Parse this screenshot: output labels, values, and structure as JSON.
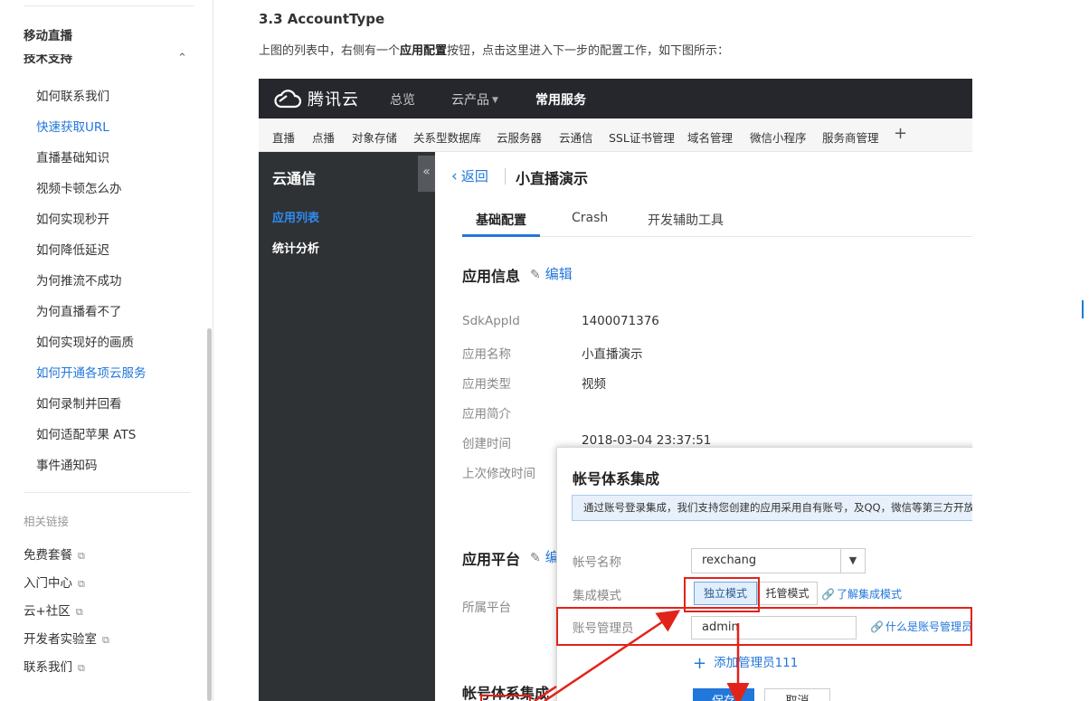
{
  "sidebar": {
    "section_live": "移动直播",
    "section_support": "技术支持",
    "items": [
      {
        "label": "如何联系我们",
        "active": false
      },
      {
        "label": "快速获取URL",
        "active": true
      },
      {
        "label": "直播基础知识",
        "active": false
      },
      {
        "label": "视频卡顿怎么办",
        "active": false
      },
      {
        "label": "如何实现秒开",
        "active": false
      },
      {
        "label": "如何降低延迟",
        "active": false
      },
      {
        "label": "为何推流不成功",
        "active": false
      },
      {
        "label": "为何直播看不了",
        "active": false
      },
      {
        "label": "如何实现好的画质",
        "active": false
      },
      {
        "label": "如何开通各项云服务",
        "active": true
      },
      {
        "label": "如何录制并回看",
        "active": false
      },
      {
        "label": "如何适配苹果 ATS",
        "active": false
      },
      {
        "label": "事件通知码",
        "active": false
      }
    ],
    "related_title": "相关链接",
    "links": [
      "免费套餐",
      "入门中心",
      "云+社区",
      "开发者实验室",
      "联系我们"
    ]
  },
  "doc": {
    "heading": "3.3 AccountType",
    "para_before": "上图的列表中，右侧有一个",
    "para_bold": "应用配置",
    "para_after": "按钮，点击这里进入下一步的配置工作，如下图所示："
  },
  "console": {
    "brand": "腾讯云",
    "topnav": [
      "总览",
      "云产品",
      "常用服务"
    ],
    "products": [
      "直播",
      "点播",
      "对象存储",
      "关系型数据库",
      "云服务器",
      "云通信",
      "SSL证书管理",
      "域名管理",
      "微信小程序",
      "服务商管理"
    ],
    "leftnav": {
      "title": "云通信",
      "items": [
        "应用列表",
        "统计分析"
      ]
    },
    "back": "返回",
    "app_title": "小直播演示",
    "tabs": [
      "基础配置",
      "Crash",
      "开发辅助工具"
    ],
    "info_section": "应用信息",
    "edit": "编辑",
    "fields": [
      {
        "label": "SdkAppId",
        "value": "1400071376"
      },
      {
        "label": "应用名称",
        "value": "小直播演示"
      },
      {
        "label": "应用类型",
        "value": "视频"
      },
      {
        "label": "应用简介",
        "value": ""
      },
      {
        "label": "创建时间",
        "value": "2018-03-04 23:37:51"
      },
      {
        "label": "上次修改时间",
        "value": ""
      }
    ],
    "platform_section": "应用平台",
    "platform_edit": "编",
    "platform_label": "所属平台",
    "account_section": "帐号体系集成"
  },
  "dialog": {
    "title": "帐号体系集成",
    "tip": "通过账号登录集成，我们支持您创建的应用采用自有账号，及QQ，微信等第三方开放账号",
    "account_name_label": "帐号名称",
    "account_name_value": "rexchang",
    "mode_label": "集成模式",
    "mode_standalone": "独立模式",
    "mode_hosted": "托管模式",
    "mode_help": "了解集成模式",
    "admin_label": "账号管理员",
    "admin_value": "admin",
    "admin_help": "什么是账号管理员",
    "add_admin": "添加管理员111",
    "save": "保存",
    "cancel": "取消"
  },
  "colors": {
    "accent": "#2277da",
    "annotation": "#e2231a",
    "topbar": "#25272c",
    "leftnav": "#2f3235"
  }
}
